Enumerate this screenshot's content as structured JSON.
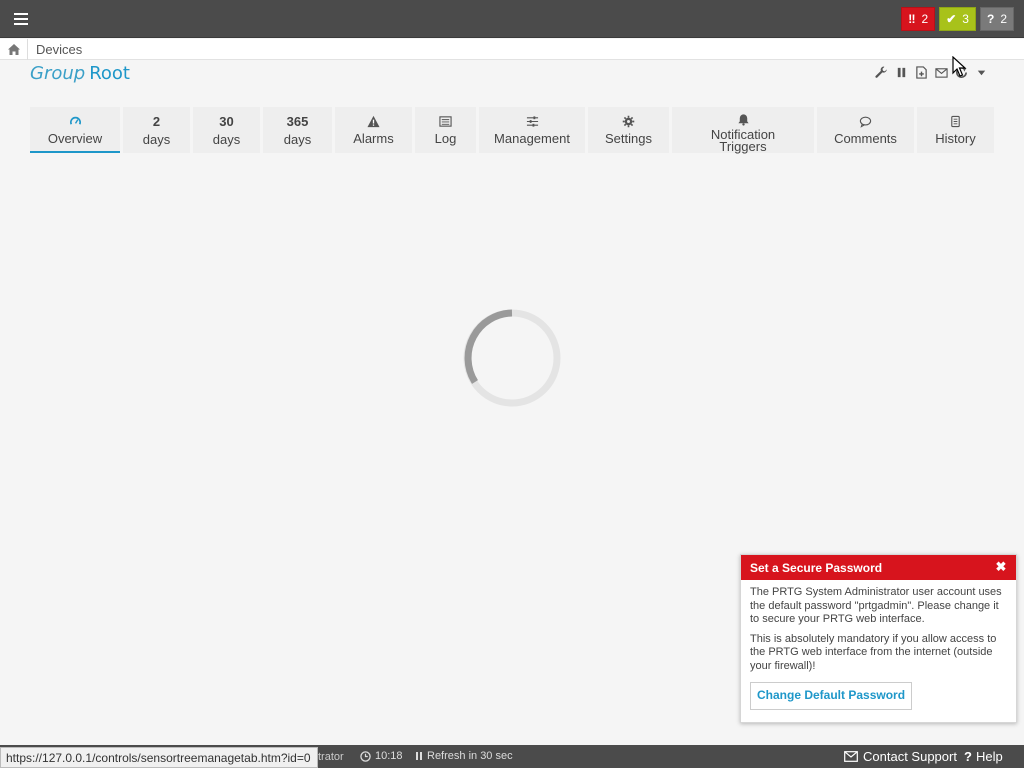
{
  "header": {
    "menu_icon": "hamburger-icon",
    "badges": [
      {
        "symbol": "‼",
        "count": "2",
        "color": "#d7141d",
        "meaning": "down"
      },
      {
        "symbol": "✔",
        "count": "3",
        "color": "#a8c21a",
        "meaning": "up"
      },
      {
        "symbol": "?",
        "count": "2",
        "color": "#7a7a7a",
        "meaning": "unknown"
      }
    ]
  },
  "breadcrumb": {
    "home_icon": "home-icon",
    "items": [
      "Devices"
    ]
  },
  "page": {
    "kind": "Group",
    "name": "Root",
    "accent": "#1e97c9"
  },
  "tools": [
    "wrench-icon",
    "pause-icon",
    "add-object-icon",
    "email-icon",
    "refresh-icon",
    "dropdown-caret-icon"
  ],
  "tabs": [
    {
      "icon": "overview-gauge-icon",
      "num": "",
      "label": "Overview",
      "active": true
    },
    {
      "icon": "",
      "num": "2",
      "label": "days"
    },
    {
      "icon": "",
      "num": "30",
      "label": "days"
    },
    {
      "icon": "",
      "num": "365",
      "label": "days"
    },
    {
      "icon": "warning-triangle-icon",
      "num": "",
      "label": "Alarms"
    },
    {
      "icon": "log-list-icon",
      "num": "",
      "label": "Log"
    },
    {
      "icon": "sliders-icon",
      "num": "",
      "label": "Management"
    },
    {
      "icon": "gear-icon",
      "num": "",
      "label": "Settings"
    },
    {
      "icon": "bell-icon",
      "num": "",
      "label": "Notification Triggers"
    },
    {
      "icon": "comment-icon",
      "num": "",
      "label": "Comments"
    },
    {
      "icon": "history-icon",
      "num": "",
      "label": "History"
    }
  ],
  "popup": {
    "title": "Set a Secure Password",
    "paragraph1": "The PRTG System Administrator user account uses the default password \"prtgadmin\". Please change it to secure your PRTG web interface.",
    "paragraph2": "This is absolutely mandatory if you allow access to the PRTG web interface from the internet (outside your firewall)!",
    "button": "Change Default Password",
    "color": "#d7141d"
  },
  "footer": {
    "url_tooltip": "https://127.0.0.1/controls/sensortreemanagetab.htm?id=0",
    "user_fragment": "trator",
    "time": "10:18",
    "refresh": "Refresh in 30 sec",
    "contact": "Contact Support",
    "help": "Help"
  }
}
